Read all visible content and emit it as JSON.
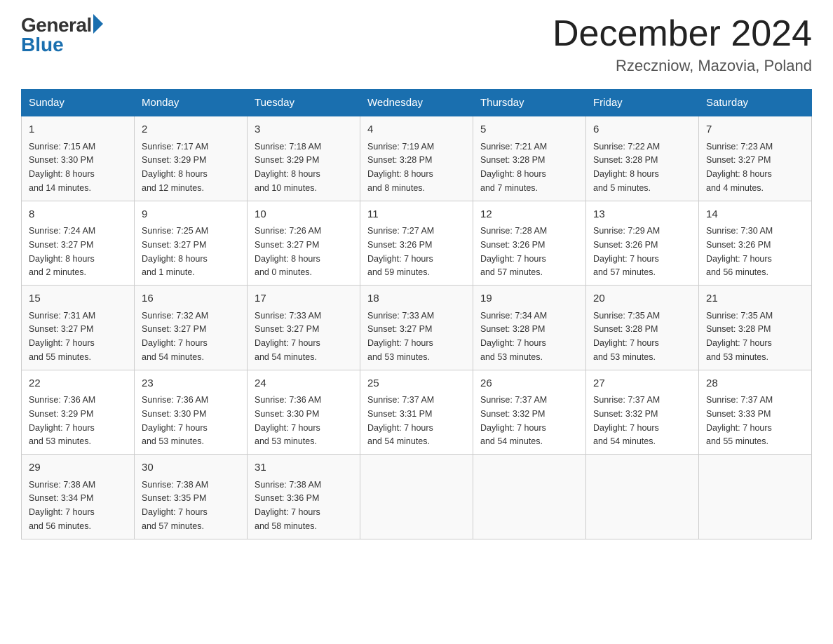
{
  "logo": {
    "general": "General",
    "blue": "Blue"
  },
  "title": "December 2024",
  "subtitle": "Rzeczniow, Mazovia, Poland",
  "days_of_week": [
    "Sunday",
    "Monday",
    "Tuesday",
    "Wednesday",
    "Thursday",
    "Friday",
    "Saturday"
  ],
  "weeks": [
    [
      {
        "day": "1",
        "sunrise": "7:15 AM",
        "sunset": "3:30 PM",
        "daylight": "8 hours and 14 minutes."
      },
      {
        "day": "2",
        "sunrise": "7:17 AM",
        "sunset": "3:29 PM",
        "daylight": "8 hours and 12 minutes."
      },
      {
        "day": "3",
        "sunrise": "7:18 AM",
        "sunset": "3:29 PM",
        "daylight": "8 hours and 10 minutes."
      },
      {
        "day": "4",
        "sunrise": "7:19 AM",
        "sunset": "3:28 PM",
        "daylight": "8 hours and 8 minutes."
      },
      {
        "day": "5",
        "sunrise": "7:21 AM",
        "sunset": "3:28 PM",
        "daylight": "8 hours and 7 minutes."
      },
      {
        "day": "6",
        "sunrise": "7:22 AM",
        "sunset": "3:28 PM",
        "daylight": "8 hours and 5 minutes."
      },
      {
        "day": "7",
        "sunrise": "7:23 AM",
        "sunset": "3:27 PM",
        "daylight": "8 hours and 4 minutes."
      }
    ],
    [
      {
        "day": "8",
        "sunrise": "7:24 AM",
        "sunset": "3:27 PM",
        "daylight": "8 hours and 2 minutes."
      },
      {
        "day": "9",
        "sunrise": "7:25 AM",
        "sunset": "3:27 PM",
        "daylight": "8 hours and 1 minute."
      },
      {
        "day": "10",
        "sunrise": "7:26 AM",
        "sunset": "3:27 PM",
        "daylight": "8 hours and 0 minutes."
      },
      {
        "day": "11",
        "sunrise": "7:27 AM",
        "sunset": "3:26 PM",
        "daylight": "7 hours and 59 minutes."
      },
      {
        "day": "12",
        "sunrise": "7:28 AM",
        "sunset": "3:26 PM",
        "daylight": "7 hours and 57 minutes."
      },
      {
        "day": "13",
        "sunrise": "7:29 AM",
        "sunset": "3:26 PM",
        "daylight": "7 hours and 57 minutes."
      },
      {
        "day": "14",
        "sunrise": "7:30 AM",
        "sunset": "3:26 PM",
        "daylight": "7 hours and 56 minutes."
      }
    ],
    [
      {
        "day": "15",
        "sunrise": "7:31 AM",
        "sunset": "3:27 PM",
        "daylight": "7 hours and 55 minutes."
      },
      {
        "day": "16",
        "sunrise": "7:32 AM",
        "sunset": "3:27 PM",
        "daylight": "7 hours and 54 minutes."
      },
      {
        "day": "17",
        "sunrise": "7:33 AM",
        "sunset": "3:27 PM",
        "daylight": "7 hours and 54 minutes."
      },
      {
        "day": "18",
        "sunrise": "7:33 AM",
        "sunset": "3:27 PM",
        "daylight": "7 hours and 53 minutes."
      },
      {
        "day": "19",
        "sunrise": "7:34 AM",
        "sunset": "3:28 PM",
        "daylight": "7 hours and 53 minutes."
      },
      {
        "day": "20",
        "sunrise": "7:35 AM",
        "sunset": "3:28 PM",
        "daylight": "7 hours and 53 minutes."
      },
      {
        "day": "21",
        "sunrise": "7:35 AM",
        "sunset": "3:28 PM",
        "daylight": "7 hours and 53 minutes."
      }
    ],
    [
      {
        "day": "22",
        "sunrise": "7:36 AM",
        "sunset": "3:29 PM",
        "daylight": "7 hours and 53 minutes."
      },
      {
        "day": "23",
        "sunrise": "7:36 AM",
        "sunset": "3:30 PM",
        "daylight": "7 hours and 53 minutes."
      },
      {
        "day": "24",
        "sunrise": "7:36 AM",
        "sunset": "3:30 PM",
        "daylight": "7 hours and 53 minutes."
      },
      {
        "day": "25",
        "sunrise": "7:37 AM",
        "sunset": "3:31 PM",
        "daylight": "7 hours and 54 minutes."
      },
      {
        "day": "26",
        "sunrise": "7:37 AM",
        "sunset": "3:32 PM",
        "daylight": "7 hours and 54 minutes."
      },
      {
        "day": "27",
        "sunrise": "7:37 AM",
        "sunset": "3:32 PM",
        "daylight": "7 hours and 54 minutes."
      },
      {
        "day": "28",
        "sunrise": "7:37 AM",
        "sunset": "3:33 PM",
        "daylight": "7 hours and 55 minutes."
      }
    ],
    [
      {
        "day": "29",
        "sunrise": "7:38 AM",
        "sunset": "3:34 PM",
        "daylight": "7 hours and 56 minutes."
      },
      {
        "day": "30",
        "sunrise": "7:38 AM",
        "sunset": "3:35 PM",
        "daylight": "7 hours and 57 minutes."
      },
      {
        "day": "31",
        "sunrise": "7:38 AM",
        "sunset": "3:36 PM",
        "daylight": "7 hours and 58 minutes."
      },
      null,
      null,
      null,
      null
    ]
  ],
  "labels": {
    "sunrise": "Sunrise:",
    "sunset": "Sunset:",
    "daylight": "Daylight:"
  }
}
